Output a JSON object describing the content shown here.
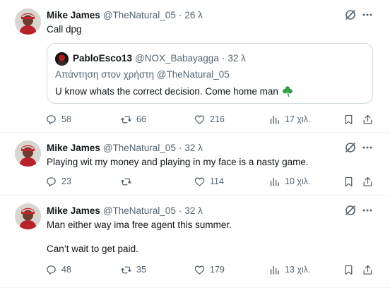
{
  "colors": {
    "text": "#0f1419",
    "secondary": "#536471",
    "border": "#cfd9de",
    "divider": "#eff3f4",
    "emoji": "#2f9e44"
  },
  "tweets": [
    {
      "name": "Mike James",
      "handle": "@TheNatural_05",
      "dot": "·",
      "time": "26 λ",
      "text": [
        "Call dpg"
      ],
      "quote": {
        "name": "PabloEsco13",
        "handle": "@NOX_Babayagga",
        "dot": "·",
        "time": "32 λ",
        "reply_prefix": "Απάντηση στον χρήστη ",
        "reply_mention": "@TheNatural_05",
        "text": "U know whats the correct decision. Come home man",
        "emoji": "shamrock-icon"
      },
      "stats": {
        "replies": "58",
        "retweets": "66",
        "likes": "216",
        "views": "17 χιλ."
      }
    },
    {
      "name": "Mike James",
      "handle": "@TheNatural_05",
      "dot": "·",
      "time": "32 λ",
      "text": [
        "Playing wit my money and playing in my face is a nasty game."
      ],
      "stats": {
        "replies": "23",
        "retweets": "",
        "likes": "114",
        "views": "10 χιλ."
      }
    },
    {
      "name": "Mike James",
      "handle": "@TheNatural_05",
      "dot": "·",
      "time": "32 λ",
      "text": [
        "Man either way ima free agent this summer.",
        "Can’t wait to get paid."
      ],
      "stats": {
        "replies": "48",
        "retweets": "35",
        "likes": "179",
        "views": "13 χιλ."
      }
    }
  ]
}
